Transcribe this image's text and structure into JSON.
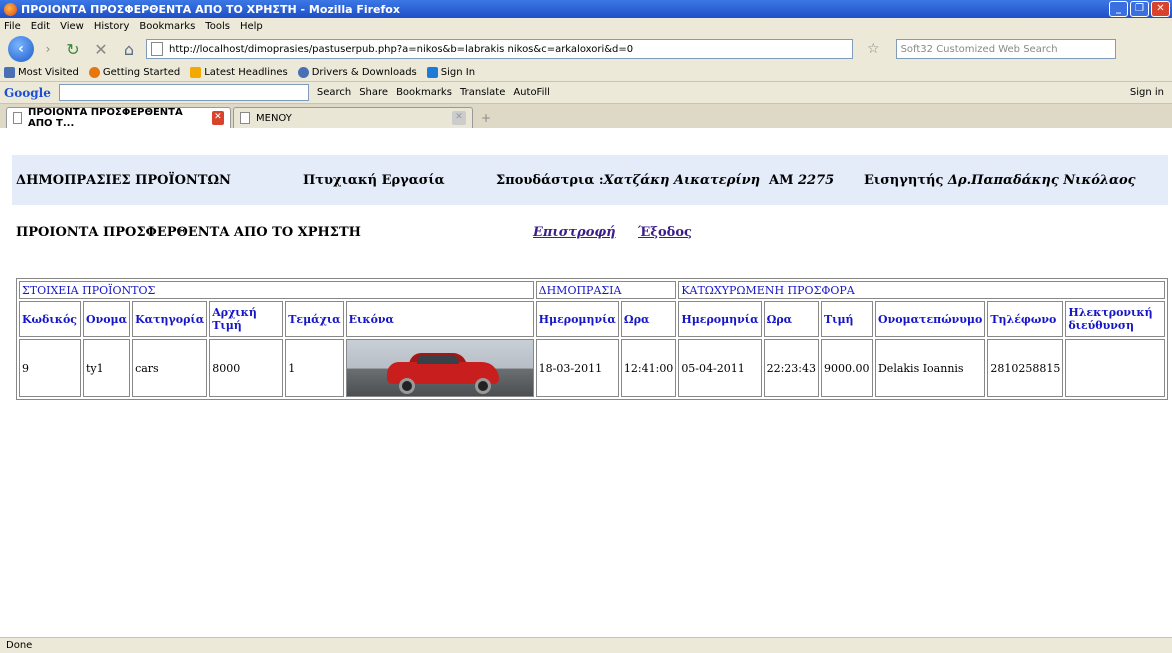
{
  "window": {
    "title": "ΠΡΟΙΟΝΤΑ ΠΡΟΣΦΕΡΘΕΝΤΑ ΑΠΟ ΤΟ ΧΡΗΣΤΗ - Mozilla Firefox"
  },
  "menu": [
    "File",
    "Edit",
    "View",
    "History",
    "Bookmarks",
    "Tools",
    "Help"
  ],
  "nav": {
    "url": "http://localhost/dimoprasies/pastuserpub.php?a=nikos&b=labrakis nikos&c=arkaloxori&d=0",
    "search_placeholder": "Soft32 Customized Web Search"
  },
  "bookmarks": [
    {
      "label": "Most Visited",
      "color": "#4a6fb5"
    },
    {
      "label": "Getting Started",
      "color": "#e8760e"
    },
    {
      "label": "Latest Headlines",
      "color": "#f2a900"
    },
    {
      "label": "Drivers & Downloads",
      "color": "#4a6fb5"
    },
    {
      "label": "Sign In",
      "color": "#1e7bd8"
    }
  ],
  "google": {
    "logo": "Google",
    "items": [
      "Search",
      "Share",
      "Bookmarks",
      "Translate",
      "AutoFill"
    ],
    "signin": "Sign in"
  },
  "tabs": [
    {
      "label": "ΠΡΟΙΟΝΤΑ ΠΡΟΣΦΕΡΘΕΝΤΑ ΑΠΟ Τ...",
      "active": true
    },
    {
      "label": "MENOY",
      "active": false
    }
  ],
  "page": {
    "header": {
      "site": "ΔΗΜΟΠΡΑΣΙΕΣ ΠΡΟΪΟΝΤΩΝ",
      "thesis": "Πτυχιακή Εργασία",
      "student_label": "Σπουδάστρια :",
      "student_name": "Χατζάκη Αικατερίνη",
      "am_label": "AM",
      "am_value": "2275",
      "supervisor_label": "Εισηγητής",
      "supervisor_name": "Δρ.Παπαδάκης Νικόλαος"
    },
    "subtitle": "ΠΡΟΙΟΝΤΑ ΠΡΟΣΦΕΡΘΕΝΤΑ ΑΠΟ ΤΟ ΧΡΗΣΤΗ",
    "back_link": "Επιστροφή",
    "exit_link": "Έξοδος",
    "table": {
      "groups": [
        "ΣΤΟΙΧΕΙΑ ΠΡΟΪΟΝΤΟΣ",
        "ΔΗΜΟΠΡΑΣΙΑ",
        "ΚΑΤΩΧΥΡΩΜΕΝΗ ΠΡΟΣΦΟΡΑ"
      ],
      "columns": [
        "Κωδικός",
        "Ονομα",
        "Κατηγορία",
        "Αρχική Τιμή",
        "Τεμάχια",
        "Εικόνα",
        "Ημερομηνία",
        "Ωρα",
        "Ημερομηνία",
        "Ωρα",
        "Τιμή",
        "Ονοματεπώνυμο",
        "Τηλέφωνο",
        "Ηλεκτρονική διεύθυνση"
      ],
      "rows": [
        [
          "9",
          "ty1",
          "cars",
          "8000",
          "1",
          "",
          "18-03-2011",
          "12:41:00",
          "05-04-2011",
          "22:23:43",
          "9000.00",
          "Delakis Ioannis",
          "2810258815",
          ""
        ]
      ]
    }
  },
  "status": "Done"
}
